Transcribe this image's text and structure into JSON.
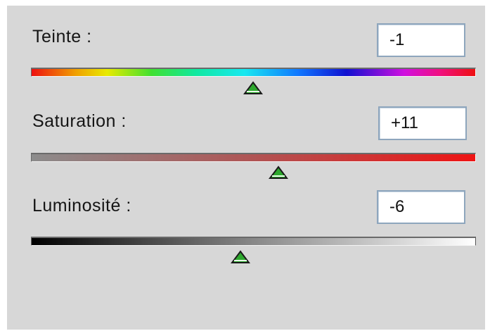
{
  "hue": {
    "label": "Teinte :",
    "value": "-1",
    "thumb_pos": 0.5
  },
  "saturation": {
    "label": "Saturation :",
    "value": "+11",
    "thumb_pos": 0.555
  },
  "luminosity": {
    "label": "Luminosité :",
    "value": "-6",
    "thumb_pos": 0.47
  },
  "colors": {
    "panel": "#d7d7d7",
    "field_border": "#8ea6bd",
    "thumb_fill": "#2ea82e"
  }
}
